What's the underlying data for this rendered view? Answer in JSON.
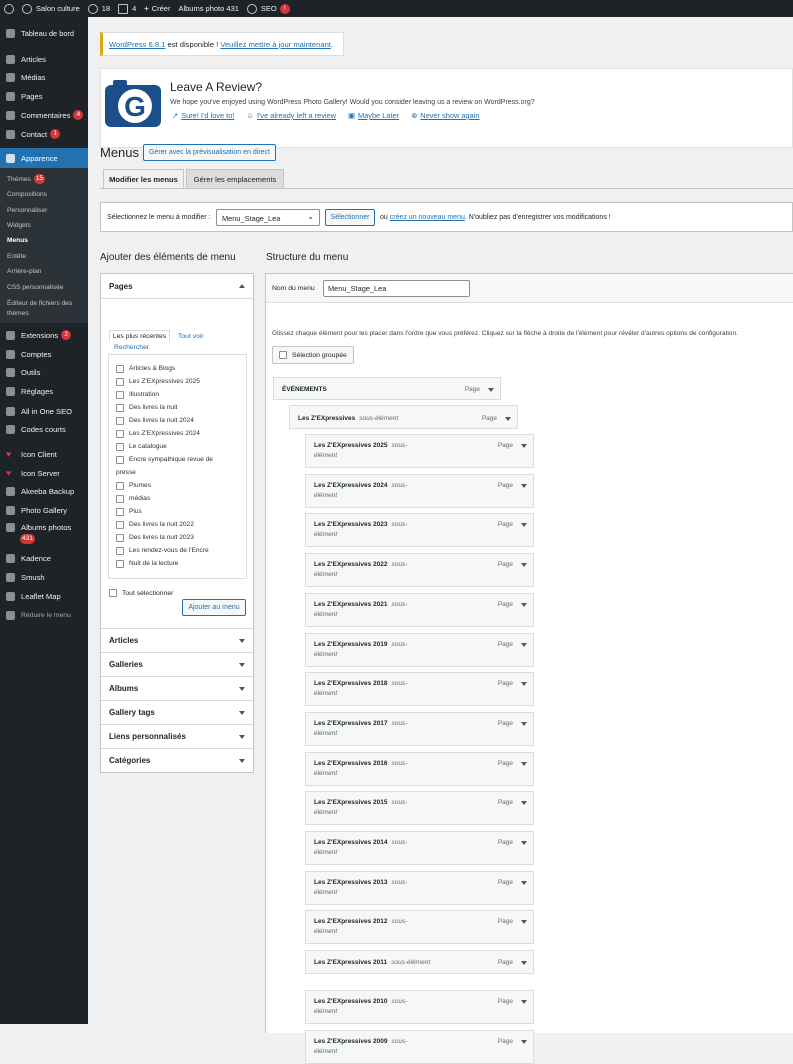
{
  "adminbar": {
    "site": "Salon culture",
    "updates": "18",
    "comments": "4",
    "new": "Créer",
    "albums": "Albums photo 431",
    "seo": "SEO",
    "seo_badge": "!"
  },
  "sidebar": {
    "items": [
      {
        "label": "Tableau de bord",
        "icon": "dashboard-icon"
      },
      {
        "label": "Articles",
        "icon": "pin-icon"
      },
      {
        "label": "Médias",
        "icon": "media-icon"
      },
      {
        "label": "Pages",
        "icon": "page-icon"
      },
      {
        "label": "Commentaires",
        "icon": "comment-icon",
        "badge": "4"
      },
      {
        "label": "Contact",
        "icon": "mail-icon",
        "badge": "1"
      },
      {
        "label": "Apparence",
        "icon": "brush-icon"
      },
      {
        "label": "Extensions",
        "icon": "plugin-icon",
        "badge": "2"
      },
      {
        "label": "Comptes",
        "icon": "users-icon"
      },
      {
        "label": "Outils",
        "icon": "wrench-icon"
      },
      {
        "label": "Réglages",
        "icon": "settings-icon"
      },
      {
        "label": "All in One SEO",
        "icon": "seo-icon"
      },
      {
        "label": "Codes courts",
        "icon": "code-icon"
      },
      {
        "label": "Icon Client",
        "icon": "heart-icon"
      },
      {
        "label": "Icon Server",
        "icon": "heart-icon"
      },
      {
        "label": "Akeeba Backup",
        "icon": "backup-icon"
      },
      {
        "label": "Photo Gallery",
        "icon": "gallery-icon"
      },
      {
        "label": "Albums photos",
        "icon": "camera-icon",
        "badge": "431"
      },
      {
        "label": "Kadence",
        "icon": "kadence-icon"
      },
      {
        "label": "Smush",
        "icon": "smush-icon"
      },
      {
        "label": "Leaflet Map",
        "icon": "map-icon"
      },
      {
        "label": "Réduire le menu",
        "icon": "collapse-icon"
      }
    ],
    "appearance_sub": [
      {
        "label": "Thèmes",
        "badge": "15"
      },
      {
        "label": "Compositions"
      },
      {
        "label": "Personnaliser"
      },
      {
        "label": "Widgets"
      },
      {
        "label": "Menus"
      },
      {
        "label": "Entête"
      },
      {
        "label": "Arrière-plan"
      },
      {
        "label": "CSS personnalisée"
      },
      {
        "label": "Éditeur de fichiers des"
      },
      {
        "label": "thèmes"
      }
    ]
  },
  "notice": {
    "version_link": "WordPress 6.8.1",
    "text": " est disponible ! ",
    "update_link": "Veuillez mettre à jour maintenant",
    "end": "."
  },
  "review": {
    "title": "Leave A Review?",
    "text": "We hope you've enjoyed using WordPress Photo Gallery! Would you consider leaving us a review on WordPress.org?",
    "links": [
      "Sure! I'd love to!",
      "I've already left a review",
      "Maybe Later",
      "Never show again"
    ]
  },
  "page": {
    "title": "Menus",
    "live_preview": "Gérer avec la prévisualisation en direct",
    "tabs": [
      "Modifier les menus",
      "Gérer les emplacements"
    ]
  },
  "select_bar": {
    "label": "Sélectionnez le menu à modifier :",
    "selected": "Menu_Stage_Lea",
    "button": "Sélectionner",
    "or": "ou",
    "create_link": "créez un nouveau menu",
    "hint": ". N'oubliez pas d'enregistrer vos modifications !"
  },
  "add_items": {
    "heading": "Ajouter des éléments de menu",
    "pages_title": "Pages",
    "tabs": [
      "Les plus récentes",
      "Tout voir",
      "Rechercher"
    ],
    "pages": [
      "Articles & Blogs",
      "Les Z'EXpressives 2025",
      "Illustration",
      "Des livres la nuit",
      "Des livres la nuit 2024",
      "Les Z'EXpressives 2024",
      "Le catalogue",
      "Encre sympathique revue de",
      "presse",
      "Plumes",
      "médias",
      "Plus",
      "Des livres la nuit 2022",
      "Des livres la nuit 2023",
      "Les rendez-vous de l'Encre",
      "Nuit de la lecture"
    ],
    "select_all": "Tout sélectionner",
    "add_button": "Ajouter au menu",
    "accordions": [
      "Articles",
      "Galleries",
      "Albums",
      "Gallery tags",
      "Liens personnalisés",
      "Catégories"
    ]
  },
  "structure": {
    "heading": "Structure du menu",
    "name_label": "Nom du menu",
    "name_value": "Menu_Stage_Lea",
    "instructions": "Glissez chaque élément pour les placer dans l'ordre que vous préférez. Cliquez sur la flèche à droite de l'élément pour révéler d'autres options de configuration.",
    "bulk": "Sélection groupée",
    "type_label": "Page",
    "sub_label": "sous-élément",
    "sub_label_a": "sous-",
    "sub_label_b": "élément",
    "top_item": "ÉVÉNEMENTS",
    "level1_item": "Les Z'EXpressives",
    "items": [
      "Les Z'EXpressives 2025",
      "Les Z'EXpressives 2024",
      "Les Z'EXpressives 2023",
      "Les Z'EXpressives 2022",
      "Les Z'EXpressives 2021",
      "Les Z'EXpressives 2019",
      "Les Z'EXpressives 2018",
      "Les Z'EXpressives 2017",
      "Les Z'EXpressives 2016",
      "Les Z'EXpressives 2015",
      "Les Z'EXpressives 2014",
      "Les Z'EXpressives 2013",
      "Les Z'EXpressives 2012",
      "Les Z'EXpressives 2011",
      "Les Z'EXpressives 2010",
      "Les Z'EXpressives 2009"
    ]
  }
}
